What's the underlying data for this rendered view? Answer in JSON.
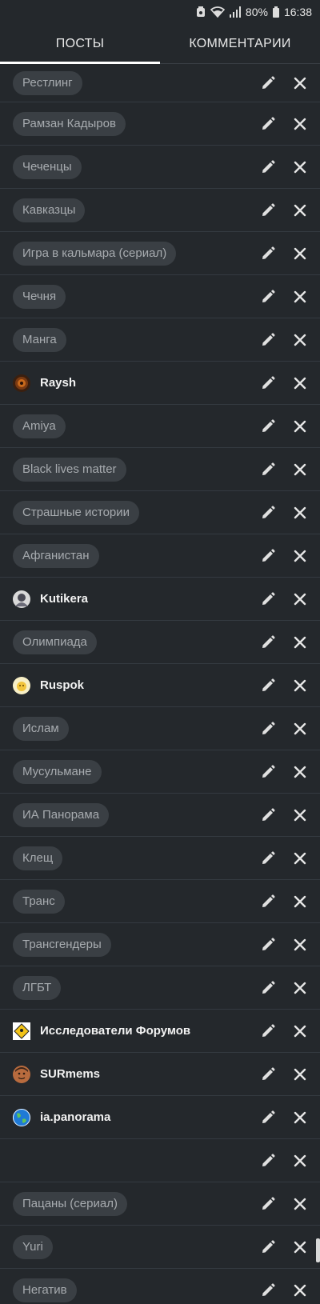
{
  "status_bar": {
    "battery": "80%",
    "time": "16:38"
  },
  "tabs": [
    {
      "label": "ПОСТЫ",
      "active": true
    },
    {
      "label": "КОММЕНТАРИИ",
      "active": false
    }
  ],
  "colors": {
    "background": "#24282c",
    "chip_bg": "#3a3f44",
    "chip_text": "#a7abaf",
    "divider": "#343a40",
    "icon": "#e0e0e0"
  },
  "rows": [
    {
      "type": "tag",
      "label": "Рестлинг"
    },
    {
      "type": "tag",
      "label": "Рамзан Кадыров"
    },
    {
      "type": "tag",
      "label": "Чеченцы"
    },
    {
      "type": "tag",
      "label": "Кавказцы"
    },
    {
      "type": "tag",
      "label": "Игра в кальмара (сериал)"
    },
    {
      "type": "tag",
      "label": "Чечня"
    },
    {
      "type": "tag",
      "label": "Манга"
    },
    {
      "type": "user",
      "label": "Raysh",
      "avatar_icon": "raysh-avatar"
    },
    {
      "type": "tag",
      "label": "Amiya"
    },
    {
      "type": "tag",
      "label": "Black lives matter"
    },
    {
      "type": "tag",
      "label": "Страшные истории"
    },
    {
      "type": "tag",
      "label": "Афганистан"
    },
    {
      "type": "user",
      "label": "Kutikera",
      "avatar_icon": "kutikera-avatar"
    },
    {
      "type": "tag",
      "label": "Олимпиада"
    },
    {
      "type": "user",
      "label": "Ruspok",
      "avatar_icon": "ruspok-avatar"
    },
    {
      "type": "tag",
      "label": "Ислам"
    },
    {
      "type": "tag",
      "label": "Мусульмане"
    },
    {
      "type": "tag",
      "label": "ИА Панорама"
    },
    {
      "type": "tag",
      "label": "Клещ"
    },
    {
      "type": "tag",
      "label": "Транс"
    },
    {
      "type": "tag",
      "label": "Трансгендеры"
    },
    {
      "type": "tag",
      "label": "ЛГБТ"
    },
    {
      "type": "user",
      "label": "Исследователи Форумов",
      "avatar_icon": "forum-researchers-avatar"
    },
    {
      "type": "user",
      "label": "SURmems",
      "avatar_icon": "surmems-avatar"
    },
    {
      "type": "user",
      "label": "ia.panorama",
      "avatar_icon": "ia-panorama-avatar"
    },
    {
      "type": "empty",
      "label": ""
    },
    {
      "type": "tag",
      "label": "Пацаны (сериал)"
    },
    {
      "type": "tag",
      "label": "Yuri"
    },
    {
      "type": "tag",
      "label": "Негатив"
    }
  ]
}
